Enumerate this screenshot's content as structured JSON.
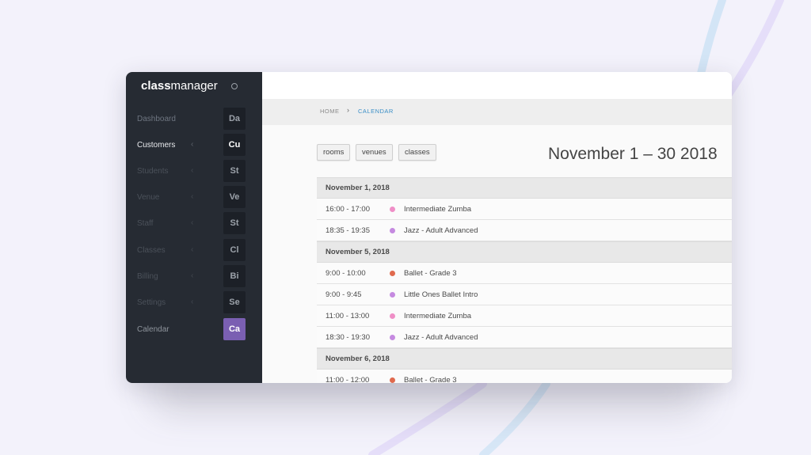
{
  "colors": {
    "sidebar_bg": "#262b33",
    "accent_purple": "#7a5fb2",
    "breadcrumb_active": "#3b8fc7",
    "dot_pink": "#ef8fc7",
    "dot_lilac": "#c58ae0",
    "dot_orange": "#e06a4e"
  },
  "app": {
    "logo_bold": "class",
    "logo_light": "manager",
    "settings_icon": "settings-circle-icon"
  },
  "sidebar": {
    "items": [
      {
        "label": "Dashboard",
        "abbr": "Da",
        "caret": ""
      },
      {
        "label": "Customers",
        "abbr": "Cu",
        "caret": "‹"
      },
      {
        "label": "Students",
        "abbr": "St",
        "caret": "‹"
      },
      {
        "label": "Venue",
        "abbr": "Ve",
        "caret": "‹"
      },
      {
        "label": "Staff",
        "abbr": "St",
        "caret": "‹"
      },
      {
        "label": "Classes",
        "abbr": "Cl",
        "caret": "‹"
      },
      {
        "label": "Billing",
        "abbr": "Bi",
        "caret": "‹"
      },
      {
        "label": "Settings",
        "abbr": "Se",
        "caret": "‹"
      },
      {
        "label": "Calendar",
        "abbr": "Ca",
        "caret": ""
      }
    ]
  },
  "breadcrumb": {
    "home": "HOME",
    "separator": "›",
    "current": "CALENDAR"
  },
  "filters": {
    "rooms": "rooms",
    "venues": "venues",
    "classes": "classes"
  },
  "calendar": {
    "range_title": "November 1 – 30 2018",
    "days": [
      {
        "date": "November 1, 2018",
        "events": [
          {
            "time": "16:00 - 17:00",
            "name": "Intermediate Zumba"
          },
          {
            "time": "18:35 - 19:35",
            "name": "Jazz - Adult Advanced"
          }
        ]
      },
      {
        "date": "November 5, 2018",
        "events": [
          {
            "time": "9:00 - 10:00",
            "name": "Ballet - Grade 3"
          },
          {
            "time": "9:00 - 9:45",
            "name": "Little Ones Ballet Intro"
          },
          {
            "time": "11:00 - 13:00",
            "name": "Intermediate Zumba"
          },
          {
            "time": "18:30 - 19:30",
            "name": "Jazz - Adult Advanced"
          }
        ]
      },
      {
        "date": "November 6, 2018",
        "events": [
          {
            "time": "11:00 - 12:00",
            "name": "Ballet - Grade 3"
          }
        ]
      }
    ]
  }
}
